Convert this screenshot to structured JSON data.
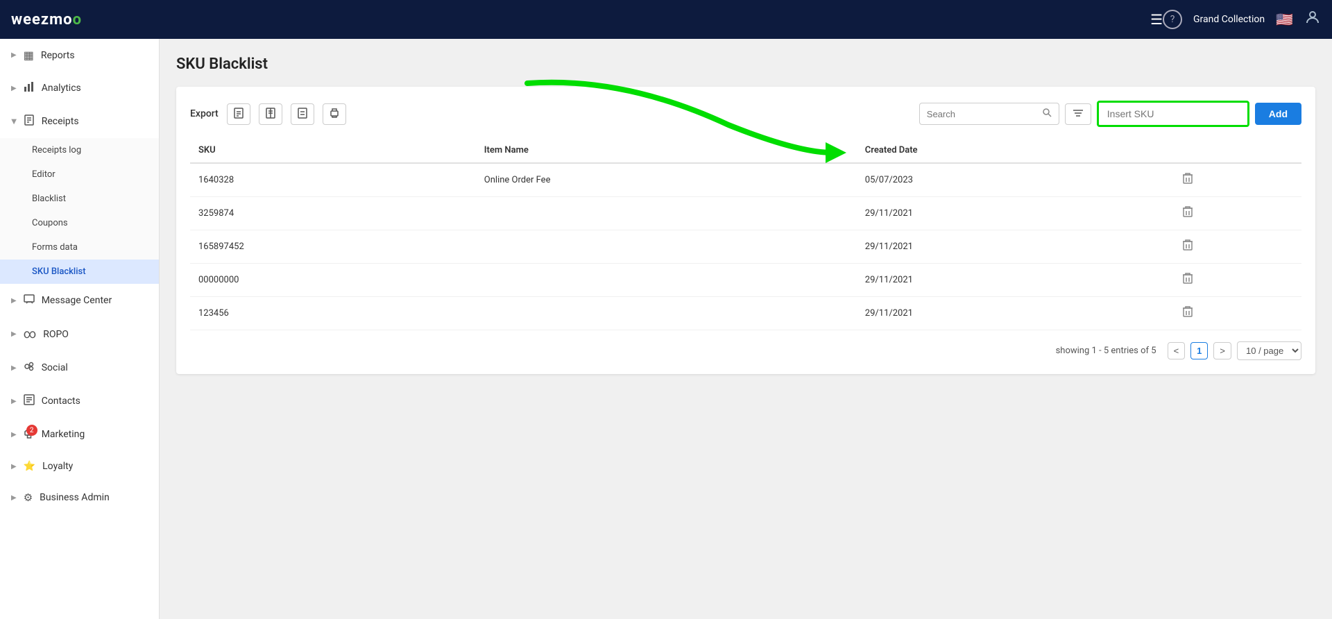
{
  "app": {
    "logo_text": "weezmo",
    "logo_accent": "o"
  },
  "header": {
    "hamburger_icon": "☰",
    "help_icon": "?",
    "company_name": "Grand Collection",
    "flag": "🇺🇸",
    "avatar_icon": "👤"
  },
  "sidebar": {
    "items": [
      {
        "id": "reports",
        "label": "Reports",
        "icon": "▦",
        "expandable": true,
        "expanded": false
      },
      {
        "id": "analytics",
        "label": "Analytics",
        "icon": "📊",
        "expandable": true,
        "expanded": false
      },
      {
        "id": "receipts",
        "label": "Receipts",
        "icon": "🧾",
        "expandable": true,
        "expanded": true,
        "subitems": [
          {
            "id": "receipts-log",
            "label": "Receipts log"
          },
          {
            "id": "editor",
            "label": "Editor"
          },
          {
            "id": "blacklist",
            "label": "Blacklist"
          },
          {
            "id": "coupons",
            "label": "Coupons"
          },
          {
            "id": "forms-data",
            "label": "Forms data"
          },
          {
            "id": "sku-blacklist",
            "label": "SKU Blacklist",
            "active": true
          }
        ]
      },
      {
        "id": "message-center",
        "label": "Message Center",
        "icon": "💬",
        "expandable": true,
        "expanded": false
      },
      {
        "id": "ropo",
        "label": "ROPO",
        "icon": "∞",
        "expandable": true,
        "expanded": false
      },
      {
        "id": "social",
        "label": "Social",
        "icon": "👥",
        "expandable": true,
        "expanded": false
      },
      {
        "id": "contacts",
        "label": "Contacts",
        "icon": "📁",
        "expandable": true,
        "expanded": false
      },
      {
        "id": "marketing",
        "label": "Marketing",
        "icon": "🎯",
        "expandable": true,
        "expanded": false,
        "badge": 2
      },
      {
        "id": "loyalty",
        "label": "Loyalty",
        "icon": "⭐",
        "expandable": true,
        "expanded": false
      },
      {
        "id": "business-admin",
        "label": "Business Admin",
        "icon": "⚙️",
        "expandable": true,
        "expanded": false
      }
    ]
  },
  "page": {
    "title": "SKU Blacklist"
  },
  "toolbar": {
    "export_label": "Export",
    "search_placeholder": "Search",
    "insert_sku_placeholder": "Insert SKU",
    "add_button_label": "Add"
  },
  "table": {
    "columns": [
      "SKU",
      "Item Name",
      "Created Date",
      ""
    ],
    "rows": [
      {
        "sku": "1640328",
        "item_name": "Online Order Fee",
        "created_date": "05/07/2023"
      },
      {
        "sku": "3259874",
        "item_name": "",
        "created_date": "29/11/2021"
      },
      {
        "sku": "165897452",
        "item_name": "",
        "created_date": "29/11/2021"
      },
      {
        "sku": "00000000",
        "item_name": "",
        "created_date": "29/11/2021"
      },
      {
        "sku": "123456",
        "item_name": "",
        "created_date": "29/11/2021"
      }
    ]
  },
  "pagination": {
    "info": "showing 1 - 5 entries of 5",
    "current_page": 1,
    "per_page": "10 / page"
  }
}
